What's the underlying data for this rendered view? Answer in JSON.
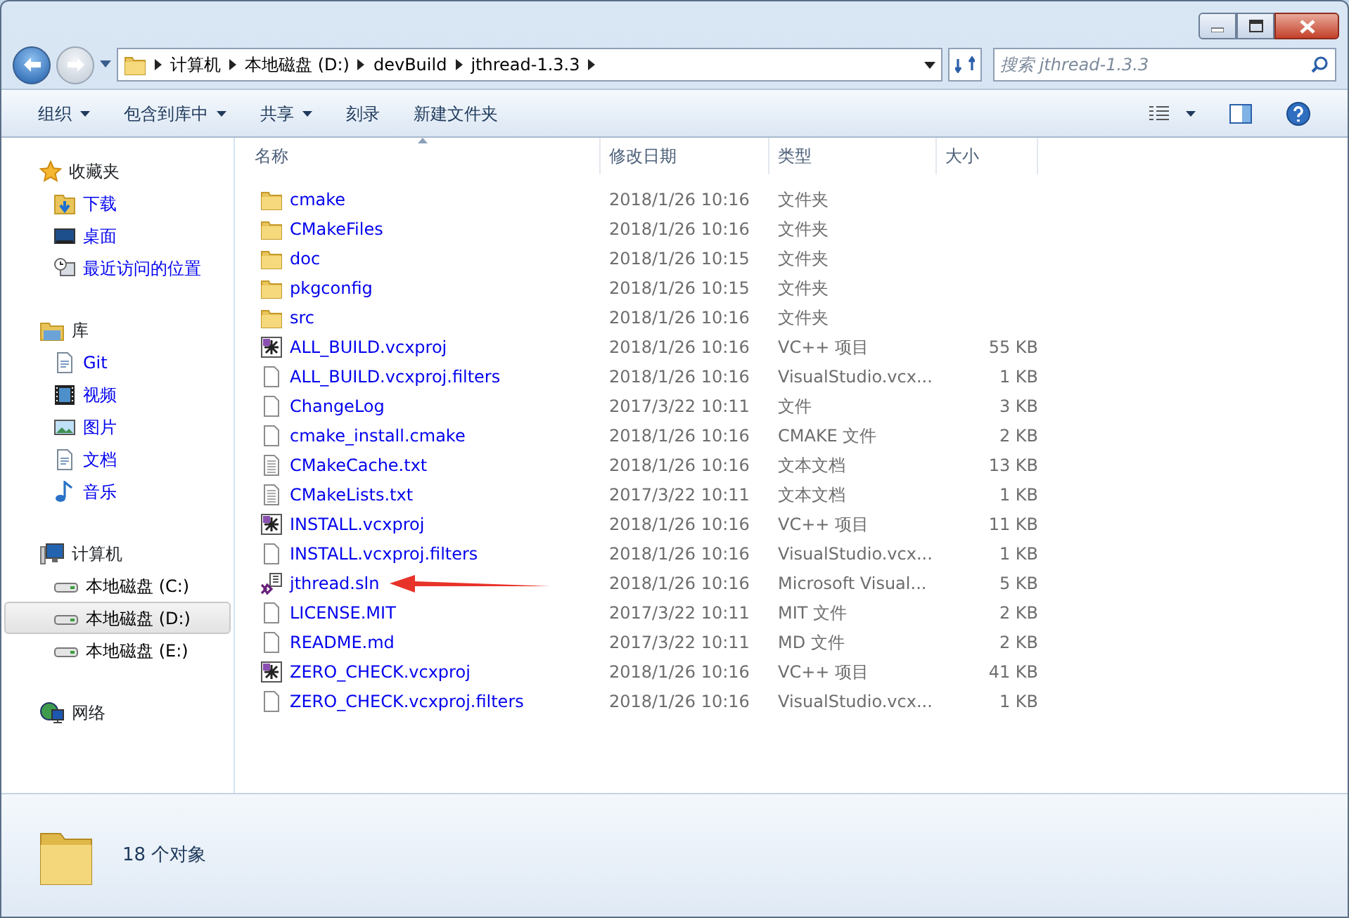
{
  "address": {
    "crumbs": [
      "计算机",
      "本地磁盘 (D:)",
      "devBuild",
      "jthread-1.3.3"
    ]
  },
  "search": {
    "placeholder": "搜索 jthread-1.3.3"
  },
  "toolbar": [
    {
      "label": "组织",
      "dropdown": true
    },
    {
      "label": "包含到库中",
      "dropdown": true
    },
    {
      "label": "共享",
      "dropdown": true
    },
    {
      "label": "刻录",
      "dropdown": false
    },
    {
      "label": "新建文件夹",
      "dropdown": false
    }
  ],
  "sidebar": {
    "items": [
      {
        "label": "收藏夹",
        "kind": "star",
        "selected": false,
        "children": [
          {
            "label": "下载",
            "kind": "download",
            "selected": false
          },
          {
            "label": "桌面",
            "kind": "desktop",
            "selected": false
          },
          {
            "label": "最近访问的位置",
            "kind": "recent",
            "selected": false
          }
        ]
      },
      {
        "label": "库",
        "kind": "library",
        "selected": false,
        "children": [
          {
            "label": "Git",
            "kind": "doc",
            "selected": false
          },
          {
            "label": "视频",
            "kind": "video",
            "selected": false
          },
          {
            "label": "图片",
            "kind": "picture",
            "selected": false
          },
          {
            "label": "文档",
            "kind": "doc",
            "selected": false
          },
          {
            "label": "音乐",
            "kind": "music",
            "selected": false
          }
        ]
      },
      {
        "label": "计算机",
        "kind": "computer",
        "selected": false,
        "children": [
          {
            "label": "本地磁盘 (C:)",
            "kind": "drive",
            "selected": false
          },
          {
            "label": "本地磁盘 (D:)",
            "kind": "drive",
            "selected": true
          },
          {
            "label": "本地磁盘 (E:)",
            "kind": "drive",
            "selected": false
          }
        ]
      },
      {
        "label": "网络",
        "kind": "network",
        "selected": false
      }
    ]
  },
  "table": {
    "columns": [
      {
        "label": "名称",
        "sorted": true
      },
      {
        "label": "修改日期",
        "sorted": false
      },
      {
        "label": "类型",
        "sorted": false
      },
      {
        "label": "大小",
        "sorted": false
      }
    ],
    "rows": [
      {
        "name": "cmake",
        "date": "2018/1/26 10:16",
        "type": "文件夹",
        "kind": "folder",
        "annotated": false
      },
      {
        "name": "CMakeFiles",
        "date": "2018/1/26 10:16",
        "type": "文件夹",
        "kind": "folder",
        "annotated": false
      },
      {
        "name": "doc",
        "date": "2018/1/26 10:15",
        "type": "文件夹",
        "kind": "folder",
        "annotated": false
      },
      {
        "name": "pkgconfig",
        "date": "2018/1/26 10:15",
        "type": "文件夹",
        "kind": "folder",
        "annotated": false
      },
      {
        "name": "src",
        "date": "2018/1/26 10:16",
        "type": "文件夹",
        "kind": "folder",
        "annotated": false
      },
      {
        "name": "ALL_BUILD.vcxproj",
        "date": "2018/1/26 10:16",
        "type": "VC++ 项目",
        "size": "55 KB",
        "kind": "project",
        "annotated": false
      },
      {
        "name": "ALL_BUILD.vcxproj.filters",
        "date": "2018/1/26 10:16",
        "type": "VisualStudio.vcx...",
        "size": "1 KB",
        "kind": "file",
        "annotated": false
      },
      {
        "name": "ChangeLog",
        "date": "2017/3/22 10:11",
        "type": "文件",
        "size": "3 KB",
        "kind": "file",
        "annotated": false
      },
      {
        "name": "cmake_install.cmake",
        "date": "2018/1/26 10:16",
        "type": "CMAKE 文件",
        "size": "2 KB",
        "kind": "file",
        "annotated": false
      },
      {
        "name": "CMakeCache.txt",
        "date": "2018/1/26 10:16",
        "type": "文本文档",
        "size": "13 KB",
        "kind": "text",
        "annotated": false
      },
      {
        "name": "CMakeLists.txt",
        "date": "2017/3/22 10:11",
        "type": "文本文档",
        "size": "1 KB",
        "kind": "text",
        "annotated": false
      },
      {
        "name": "INSTALL.vcxproj",
        "date": "2018/1/26 10:16",
        "type": "VC++ 项目",
        "size": "11 KB",
        "kind": "project",
        "annotated": false
      },
      {
        "name": "INSTALL.vcxproj.filters",
        "date": "2018/1/26 10:16",
        "type": "VisualStudio.vcx...",
        "size": "1 KB",
        "kind": "file",
        "annotated": false
      },
      {
        "name": "jthread.sln",
        "date": "2018/1/26 10:16",
        "type": "Microsoft Visual...",
        "size": "5 KB",
        "kind": "solution",
        "annotated": true
      },
      {
        "name": "LICENSE.MIT",
        "date": "2017/3/22 10:11",
        "type": "MIT 文件",
        "size": "2 KB",
        "kind": "file",
        "annotated": false
      },
      {
        "name": "README.md",
        "date": "2017/3/22 10:11",
        "type": "MD 文件",
        "size": "2 KB",
        "kind": "file",
        "annotated": false
      },
      {
        "name": "ZERO_CHECK.vcxproj",
        "date": "2018/1/26 10:16",
        "type": "VC++ 项目",
        "size": "41 KB",
        "kind": "project",
        "annotated": false
      },
      {
        "name": "ZERO_CHECK.vcxproj.filters",
        "date": "2018/1/26 10:16",
        "type": "VisualStudio.vcx...",
        "size": "1 KB",
        "kind": "file",
        "annotated": false
      }
    ]
  },
  "status_bar": {
    "count": "18 个对象"
  }
}
